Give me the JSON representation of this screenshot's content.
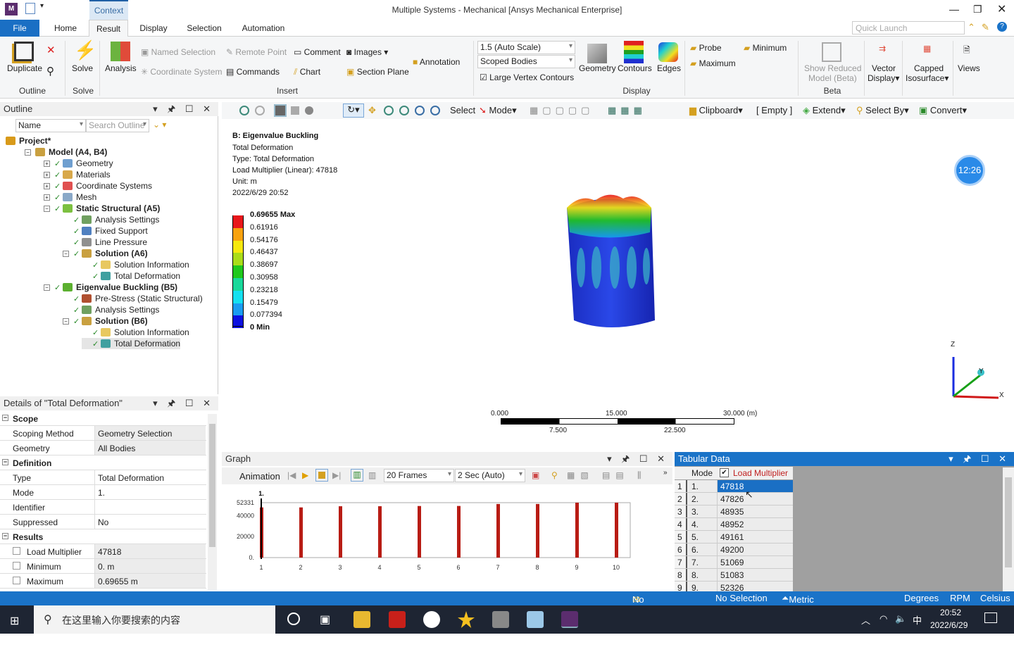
{
  "window": {
    "title": "Multiple Systems - Mechanical [Ansys Mechanical Enterprise]",
    "context_tab": "Context",
    "app_icon": "M"
  },
  "tabs": [
    "File",
    "Home",
    "Result",
    "Display",
    "Selection",
    "Automation"
  ],
  "active_tab": "Result",
  "quick_launch_placeholder": "Quick Launch",
  "ribbon": {
    "outline": {
      "duplicate": "Duplicate",
      "group": "Outline"
    },
    "solve": {
      "label": "Solve",
      "group": "Solve"
    },
    "insert": {
      "analysis": "Analysis",
      "named_selection": "Named Selection",
      "coordinate_system": "Coordinate System",
      "remote_point": "Remote Point",
      "commands": "Commands",
      "comment": "Comment",
      "chart": "Chart",
      "images": "Images",
      "section_plane": "Section Plane",
      "annotation": "Annotation",
      "group": "Insert"
    },
    "display": {
      "scale": "1.5 (Auto Scale)",
      "bodies": "Scoped Bodies",
      "large_vertex": "Large Vertex Contours",
      "large_vertex_checked": true,
      "geometry": "Geometry",
      "contours": "Contours",
      "edges": "Edges",
      "group": "Display"
    },
    "probe": "Probe",
    "maximum": "Maximum",
    "minimum": "Minimum",
    "beta": {
      "show_reduced": "Show Reduced",
      "model_beta": "Model (Beta)",
      "group": "Beta"
    },
    "vector": "Vector",
    "vector_display": "Display",
    "capped": "Capped",
    "isosurface": "Isosurface",
    "views": "Views"
  },
  "toolbar": {
    "select": "Select",
    "mode": "Mode",
    "clipboard": "Clipboard",
    "empty": "[ Empty ]",
    "extend": "Extend",
    "select_by": "Select By",
    "convert": "Convert"
  },
  "outline": {
    "title": "Outline",
    "filter": "Name",
    "search_placeholder": "Search Outline",
    "tree": [
      {
        "label": "Project*",
        "level": 0,
        "bold": true,
        "color": "#d89a1a"
      },
      {
        "label": "Model (A4, B4)",
        "level": 1,
        "bold": true,
        "color": "#c9a040",
        "exp": "-"
      },
      {
        "label": "Geometry",
        "level": 2,
        "color": "#6f9fd0",
        "exp": "+",
        "check": true
      },
      {
        "label": "Materials",
        "level": 2,
        "color": "#d8a84a",
        "exp": "+",
        "check": true
      },
      {
        "label": "Coordinate Systems",
        "level": 2,
        "color": "#e05050",
        "exp": "+",
        "check": true
      },
      {
        "label": "Mesh",
        "level": 2,
        "color": "#8aa8c8",
        "exp": "+",
        "check": true
      },
      {
        "label": "Static Structural (A5)",
        "level": 2,
        "bold": true,
        "color": "#7cc040",
        "exp": "-",
        "check": true
      },
      {
        "label": "Analysis Settings",
        "level": 3,
        "color": "#70a060",
        "check": true
      },
      {
        "label": "Fixed Support",
        "level": 3,
        "color": "#5080c0",
        "check": true
      },
      {
        "label": "Line Pressure",
        "level": 3,
        "color": "#909090",
        "check": true
      },
      {
        "label": "Solution (A6)",
        "level": 3,
        "bold": true,
        "color": "#c9a040",
        "exp": "-",
        "check": true
      },
      {
        "label": "Solution Information",
        "level": 4,
        "color": "#e8c860",
        "check": true
      },
      {
        "label": "Total Deformation",
        "level": 4,
        "color": "#40a0a0",
        "check": true
      },
      {
        "label": "Eigenvalue Buckling (B5)",
        "level": 2,
        "bold": true,
        "color": "#5cb030",
        "exp": "-",
        "check": true
      },
      {
        "label": "Pre-Stress (Static Structural)",
        "level": 3,
        "color": "#b05030",
        "check": true
      },
      {
        "label": "Analysis Settings",
        "level": 3,
        "color": "#70a060",
        "check": true
      },
      {
        "label": "Solution (B6)",
        "level": 3,
        "bold": true,
        "color": "#c9a040",
        "exp": "-",
        "check": true
      },
      {
        "label": "Solution Information",
        "level": 4,
        "color": "#e8c860",
        "check": true
      },
      {
        "label": "Total Deformation",
        "level": 4,
        "color": "#40a0a0",
        "check": true,
        "selected": true
      }
    ]
  },
  "details": {
    "title": "Details of \"Total Deformation\"",
    "rows": [
      {
        "section": "Scope"
      },
      {
        "key": "Scoping Method",
        "value": "Geometry Selection"
      },
      {
        "key": "Geometry",
        "value": "All Bodies"
      },
      {
        "section": "Definition"
      },
      {
        "key": "Type",
        "value": "Total Deformation",
        "white": true
      },
      {
        "key": "Mode",
        "value": "1.",
        "white": true
      },
      {
        "key": "Identifier",
        "value": "",
        "white": true
      },
      {
        "key": "Suppressed",
        "value": "No",
        "white": true
      },
      {
        "section": "Results"
      },
      {
        "key": "Load Multiplier",
        "value": "47818",
        "box": true
      },
      {
        "key": "Minimum",
        "value": "0. m",
        "box": true
      },
      {
        "key": "Maximum",
        "value": "0.69655 m",
        "box": true
      }
    ]
  },
  "viewport": {
    "heading": "B: Eigenvalue Buckling",
    "lines": [
      "Total Deformation",
      "Type: Total Deformation",
      "Load Multiplier (Linear): 47818",
      "Unit: m",
      "2022/6/29 20:52"
    ],
    "legend": [
      {
        "label": "0.69655 Max",
        "color": "#e8161a",
        "bold": true
      },
      {
        "label": "0.61916",
        "color": "#f7a20e"
      },
      {
        "label": "0.54176",
        "color": "#f5e80c"
      },
      {
        "label": "0.46437",
        "color": "#aadc18"
      },
      {
        "label": "0.38697",
        "color": "#1fc81c"
      },
      {
        "label": "0.30958",
        "color": "#18d89a"
      },
      {
        "label": "0.23218",
        "color": "#14e0f0"
      },
      {
        "label": "0.15479",
        "color": "#1a9cf0"
      },
      {
        "label": "0.077394",
        "color": "#0c10e0"
      },
      {
        "label": "0 Min",
        "bold": true
      }
    ],
    "clock": "12:26",
    "scale_top": [
      "0.000",
      "15.000",
      "30.000 (m)"
    ],
    "scale_bottom": [
      "7.500",
      "22.500"
    ],
    "axes": {
      "x": "X",
      "y": "Y",
      "z": "Z"
    }
  },
  "graph": {
    "title": "Graph",
    "animation": "Animation",
    "frames": "20 Frames",
    "duration": "2 Sec (Auto)",
    "marker": "1.",
    "chart_data": {
      "type": "bar",
      "categories": [
        "1",
        "2",
        "3",
        "4",
        "5",
        "6",
        "7",
        "8",
        "9",
        "10"
      ],
      "values": [
        47818,
        47826,
        48935,
        48952,
        49161,
        49200,
        51069,
        51083,
        52326,
        52331
      ],
      "ylim": [
        0,
        52331
      ],
      "yticks": [
        "0.",
        "20000",
        "40000",
        "52331"
      ],
      "bar_color": "#b81c14"
    }
  },
  "tabular": {
    "title": "Tabular Data",
    "headers": [
      "Mode",
      "Load Multiplier"
    ],
    "rows": [
      [
        "1",
        "1.",
        "47818"
      ],
      [
        "2",
        "2.",
        "47826"
      ],
      [
        "3",
        "3.",
        "48935"
      ],
      [
        "4",
        "4.",
        "48952"
      ],
      [
        "5",
        "5.",
        "49161"
      ],
      [
        "6",
        "6.",
        "49200"
      ],
      [
        "7",
        "7.",
        "51069"
      ],
      [
        "8",
        "8.",
        "51083"
      ],
      [
        "9",
        "9.",
        "52326"
      ]
    ]
  },
  "status": {
    "messages": "No Messages",
    "selection": "No Selection",
    "units": "Metric (m, kg, N, s, V, A)",
    "angle": "Degrees",
    "speed": "RPM",
    "temp": "Celsius"
  },
  "taskbar": {
    "search": "在这里输入你要搜索的内容",
    "time": "20:52",
    "date": "2022/6/29",
    "ime": "中"
  }
}
